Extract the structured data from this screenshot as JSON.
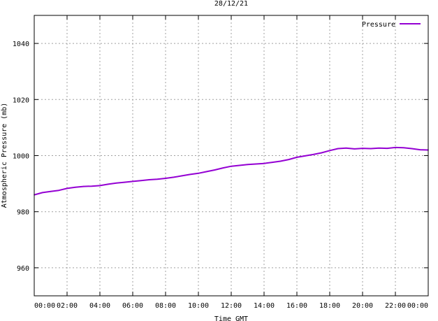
{
  "chart_data": {
    "type": "line",
    "title": "28/12/21",
    "xlabel": "Time GMT",
    "ylabel": "Atmospheric Pressure (mb)",
    "x_tick_labels": [
      "00:00",
      "02:00",
      "04:00",
      "06:00",
      "08:00",
      "10:00",
      "12:00",
      "14:00",
      "16:00",
      "18:00",
      "20:00",
      "22:00",
      "00:00"
    ],
    "x_range_hours": [
      0,
      24
    ],
    "y_ticks": [
      960,
      980,
      1000,
      1020,
      1040
    ],
    "ylim": [
      950,
      1050
    ],
    "grid": true,
    "legend_position": "top-right",
    "series": [
      {
        "name": "Pressure",
        "color": "#9400d3",
        "x_hours": [
          0,
          0.5,
          1,
          1.5,
          2,
          2.5,
          3,
          3.5,
          4,
          4.5,
          5,
          5.5,
          6,
          6.5,
          7,
          7.5,
          8,
          8.5,
          9,
          9.5,
          10,
          10.5,
          11,
          11.5,
          12,
          12.5,
          13,
          13.5,
          14,
          14.5,
          15,
          15.5,
          16,
          16.5,
          17,
          17.5,
          18,
          18.5,
          19,
          19.5,
          20,
          20.5,
          21,
          21.5,
          22,
          22.5,
          23,
          23.5,
          24
        ],
        "values": [
          986.0,
          986.8,
          987.2,
          987.6,
          988.3,
          988.7,
          989.0,
          989.1,
          989.3,
          989.8,
          990.2,
          990.5,
          990.8,
          991.1,
          991.4,
          991.6,
          991.9,
          992.3,
          992.8,
          993.3,
          993.7,
          994.3,
          994.9,
          995.6,
          996.2,
          996.5,
          996.8,
          997.0,
          997.2,
          997.6,
          998.0,
          998.6,
          999.4,
          999.9,
          1000.4,
          1001.0,
          1001.8,
          1002.5,
          1002.7,
          1002.4,
          1002.6,
          1002.5,
          1002.7,
          1002.6,
          1002.9,
          1002.8,
          1002.5,
          1002.1,
          1002.0
        ]
      }
    ]
  }
}
